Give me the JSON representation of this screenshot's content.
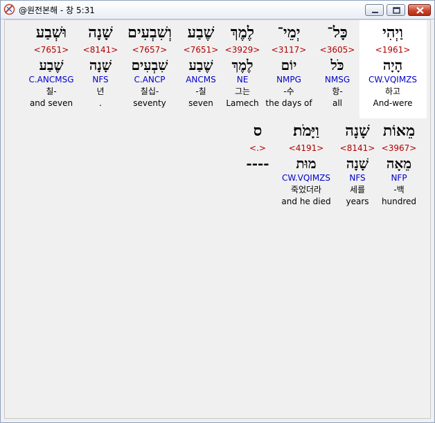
{
  "window": {
    "title": "@원전본해 - 창 5:31"
  },
  "row1": [
    {
      "heb": "וַיְהִי",
      "strong": "<1961>",
      "lemma": "הָיָה",
      "parse": "CW.VQIMZS",
      "korean": "하고",
      "english": "And-were"
    },
    {
      "heb": "כָּל־",
      "strong": "<3605>",
      "lemma": "כֹּל",
      "parse": "NMSG",
      "korean": "항-",
      "english": "all"
    },
    {
      "heb": "יְמֵי־",
      "strong": "<3117>",
      "lemma": "יוֹם",
      "parse": "NMPG",
      "korean": "-수",
      "english": "the days of"
    },
    {
      "heb": "לֶמֶךְ",
      "strong": "<3929>",
      "lemma": "לֶמֶךְ",
      "parse": "NE",
      "korean": "그는",
      "english": "Lamech"
    },
    {
      "heb": "שֶׁבַע",
      "strong": "<7651>",
      "lemma": "שֶׁבַע",
      "parse": "ANCMS",
      "korean": "-칠",
      "english": "seven"
    },
    {
      "heb": "וְשִׁבְעִים",
      "strong": "<7657>",
      "lemma": "שִׁבְעִים",
      "parse": "C.ANCP",
      "korean": "칠십-",
      "english": "seventy"
    },
    {
      "heb": "שָׁנָה",
      "strong": "<8141>",
      "lemma": "שָׁנָה",
      "parse": "NFS",
      "korean": "년",
      "english": "."
    },
    {
      "heb": "וּשְׁבַע",
      "strong": "<7651>",
      "lemma": "שֶׁבַע",
      "parse": "C.ANCMSG",
      "korean": "칠-",
      "english": "and seven"
    }
  ],
  "row2": [
    {
      "heb": "מֵאוֹת",
      "strong": "<3967>",
      "lemma": "מֵאָה",
      "parse": "NFP",
      "korean": "-백",
      "english": "hundred"
    },
    {
      "heb": "שָׁנָה",
      "strong": "<8141>",
      "lemma": "שָׁנָה",
      "parse": "NFS",
      "korean": "세를",
      "english": "years"
    },
    {
      "heb": "וַיָּמֹת׃",
      "strong": "<4191>",
      "lemma": "מוּת",
      "parse": "CW.VQIMZS",
      "korean": "죽었더라",
      "english": "and he died"
    },
    {
      "heb": "ס",
      "strong": "<.>",
      "lemma": "----",
      "parse": "",
      "korean": "",
      "english": ""
    }
  ]
}
